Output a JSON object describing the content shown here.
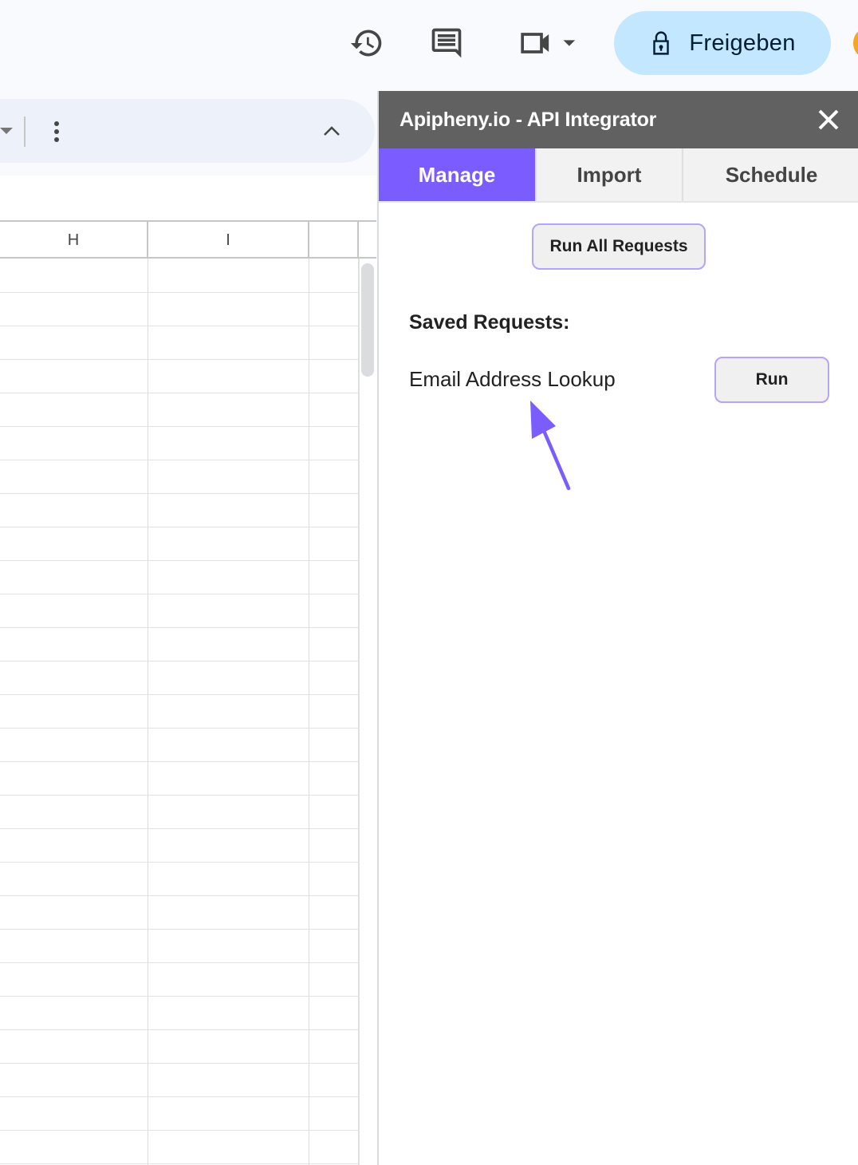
{
  "topbar": {
    "history_icon": "history-icon",
    "comment_icon": "comment-icon",
    "meet_icon": "video-camera-icon",
    "share": {
      "label": "Freigeben",
      "icon": "lock-icon",
      "color": "#c2e7ff"
    }
  },
  "sheet": {
    "columns": [
      "H",
      "I",
      ""
    ],
    "toolbar_icons": [
      "dropdown-arrow-icon",
      "more-vert-icon",
      "chevron-up-icon"
    ]
  },
  "panel": {
    "title": "Apipheny.io - API Integrator",
    "close_icon": "close-icon",
    "tabs": [
      {
        "label": "Manage",
        "active": true
      },
      {
        "label": "Import",
        "active": false
      },
      {
        "label": "Schedule",
        "active": false
      }
    ],
    "run_all_label": "Run All Requests",
    "saved_heading": "Saved Requests:",
    "requests": [
      {
        "name": "Email Address Lookup",
        "run_label": "Run"
      }
    ],
    "accent_color": "#7b5cff"
  }
}
